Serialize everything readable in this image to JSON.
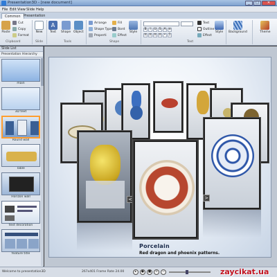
{
  "window": {
    "title": "Presentation3D - [new document]",
    "minimize": "_",
    "maximize": "□",
    "close": "✕"
  },
  "menu": [
    "File",
    "Edit",
    "View",
    "Slide",
    "Help"
  ],
  "ribbon_tabs": [
    "Common",
    "Presentation"
  ],
  "ribbon": {
    "clipboard": {
      "paste": "Paste",
      "cut": "Cut",
      "copy": "Copy",
      "format": "Format",
      "group": "Clipboard"
    },
    "slide": {
      "new": "New",
      "group": "Slide"
    },
    "tools": {
      "text": "Text",
      "shape": "Shape",
      "object": "Object",
      "group": "Tools"
    },
    "arrange": {
      "arrange": "Arrange",
      "shape_type": "Shape Type",
      "properties": "Properti",
      "fill": "Fill",
      "border": "Bord",
      "effect": "Effect",
      "style": "Style",
      "group": "Shape"
    },
    "text": {
      "text": "Text",
      "outline": "Outline",
      "effect": "Effect",
      "group": "Text"
    },
    "style_btn": "Style",
    "background": "Background",
    "theme": "Theme"
  },
  "sidebar": {
    "title": "Slide List",
    "tabs": [
      "Presentation",
      "Hierarchy"
    ],
    "slides": [
      {
        "label": "main"
      },
      {
        "label": "3D text"
      },
      {
        "label": "Round wall"
      },
      {
        "label": "Table"
      },
      {
        "label": "Horizon wall"
      },
      {
        "label": "text decoration"
      },
      {
        "label": "feature title"
      }
    ]
  },
  "stage": {
    "caption_title": "Porcelain",
    "caption_text": "Red dragon and phoenix patterns.",
    "prev": "<",
    "next": ">"
  },
  "status": {
    "left": "Welcome to presentation3D",
    "frame": "267x401 Frame Rate 24.00"
  },
  "watermark": "zaycikat.ua",
  "colors": {
    "accent": "#ff9d2e",
    "ribbon": "#d9e0ea",
    "canvas": "#eef3f9"
  }
}
